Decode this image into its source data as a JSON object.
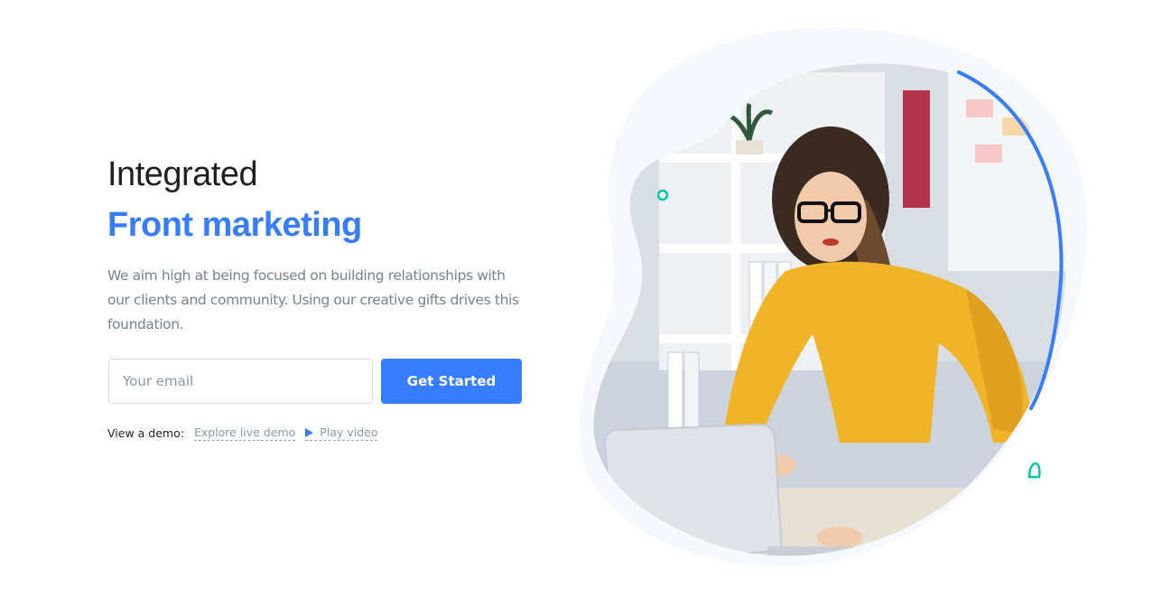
{
  "hero": {
    "headline_light": "Integrated",
    "headline_bold": "Front marketing",
    "lead": "We aim high at being focused on building relationships with our clients and community. Using our creative gifts drives this foundation."
  },
  "form": {
    "email_placeholder": "Your email",
    "submit_label": "Get Started"
  },
  "demo": {
    "label": "View a demo:",
    "explore_link": "Explore live demo",
    "play_link": "Play video",
    "play_icon": "play-icon"
  },
  "colors": {
    "primary": "#377dff",
    "text_dark": "#1e2022",
    "text_muted": "#77838f",
    "accent_teal": "#00c9a7",
    "blob_bg": "#f5f8fd",
    "sweater": "#f0b429"
  }
}
